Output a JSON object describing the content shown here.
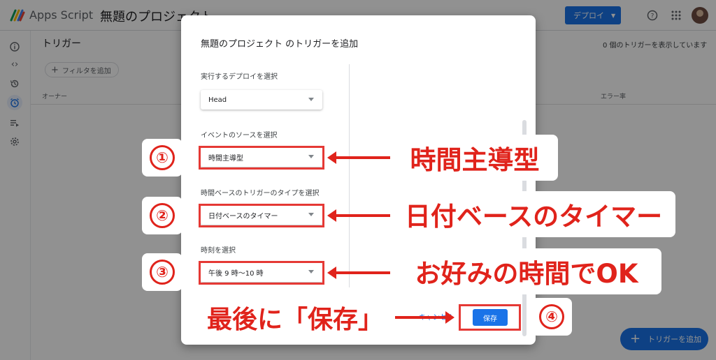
{
  "header": {
    "app_name": "Apps Script",
    "project_name": "無題のプロジェクト",
    "deploy_label": "デプロイ"
  },
  "left_rail": {
    "icons": [
      "info-icon",
      "code-icon",
      "history-icon",
      "alarm-clock-icon",
      "run-list-icon",
      "settings-icon"
    ],
    "active": "alarm-clock-icon"
  },
  "page": {
    "title": "トリガー",
    "trigger_count": "0 個のトリガーを表示しています",
    "filter_label": "フィルタを追加",
    "columns": [
      "オーナー",
      "エラー率"
    ],
    "add_trigger_label": "トリガーを追加"
  },
  "dialog": {
    "title": "無題のプロジェクト のトリガーを追加",
    "deployment": {
      "label": "実行するデプロイを選択",
      "value": "Head"
    },
    "event_source": {
      "label": "イベントのソースを選択",
      "value": "時間主導型"
    },
    "trigger_type": {
      "label": "時間ベースのトリガーのタイプを選択",
      "value": "日付ベースのタイマー"
    },
    "time_of_day": {
      "label": "時刻を選択",
      "value": "午後 9 時〜10 時"
    },
    "cancel_label": "キャンセル",
    "save_label": "保存"
  },
  "annotations": {
    "marker_1": "①",
    "marker_2": "②",
    "marker_3": "③",
    "marker_4": "④",
    "callout_1": "時間主導型",
    "callout_2": "日付ベースのタイマー",
    "callout_3": "お好みの時間でOK",
    "callout_4": "最後に「保存」"
  },
  "colors": {
    "accent_blue": "#1a73e8",
    "annotation_red": "#e0231b"
  }
}
